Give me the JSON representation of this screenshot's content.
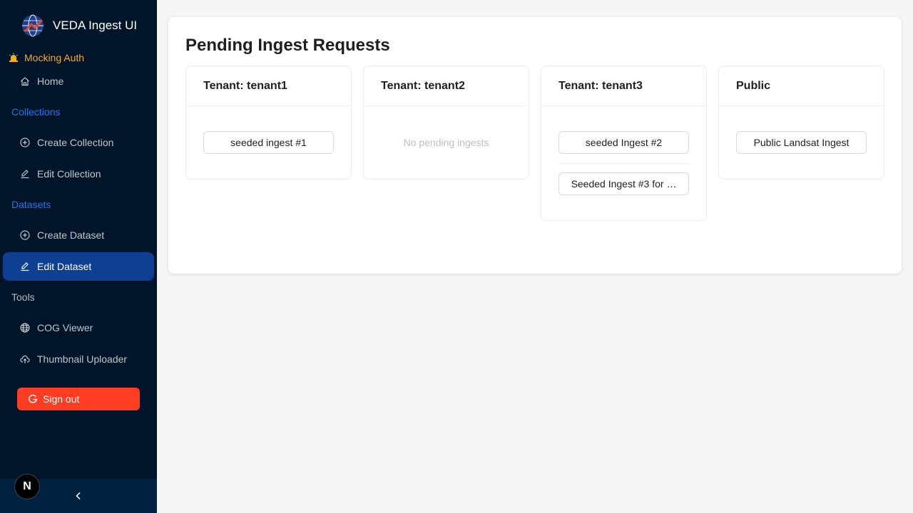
{
  "app": {
    "title": "VEDA Ingest UI"
  },
  "sidebar": {
    "mock_auth": "Mocking Auth",
    "home": "Home",
    "collections_label": "Collections",
    "create_collection": "Create Collection",
    "edit_collection": "Edit Collection",
    "datasets_label": "Datasets",
    "create_dataset": "Create Dataset",
    "edit_dataset": "Edit Dataset",
    "tools_label": "Tools",
    "cog_viewer": "COG Viewer",
    "thumbnail_uploader": "Thumbnail Uploader",
    "sign_out": "Sign out",
    "next_badge": "N",
    "collapse_icon": "chevron-left-icon",
    "accent_color": "#0e3f93"
  },
  "main": {
    "title": "Pending Ingest Requests",
    "cards": [
      {
        "title": "Tenant: tenant1",
        "ingests": [
          "seeded ingest #1"
        ]
      },
      {
        "title": "Tenant: tenant2",
        "empty_text": "No pending ingests"
      },
      {
        "title": "Tenant: tenant3",
        "ingests": [
          "seeded Ingest #2",
          "Seeded Ingest #3 for …"
        ]
      },
      {
        "title": "Public",
        "ingests": [
          "Public Landsat Ingest"
        ]
      }
    ]
  },
  "colors": {
    "signout": "#ff3d22",
    "sidebar_bg": "#001529",
    "warning": "#faad14",
    "link": "#1677ff"
  }
}
